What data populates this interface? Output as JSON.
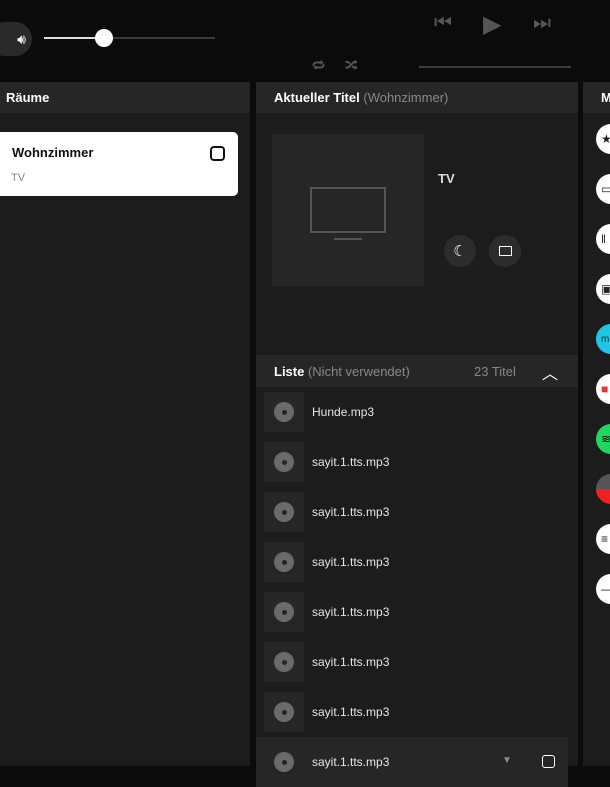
{
  "player": {
    "volume_percent": 35,
    "progress_percent": 0
  },
  "rooms": {
    "title": "Räume",
    "items": [
      {
        "name": "Wohnzimmer",
        "device": "TV"
      }
    ]
  },
  "current": {
    "title": "Aktueller Titel",
    "room": "(Wohnzimmer)",
    "track": "TV"
  },
  "list": {
    "title": "Liste",
    "status": "(Nicht verwendet)",
    "count": "23 Titel",
    "items": [
      "Hunde.mp3",
      "sayit.1.tts.mp3",
      "sayit.1.tts.mp3",
      "sayit.1.tts.mp3",
      "sayit.1.tts.mp3",
      "sayit.1.tts.mp3",
      "sayit.1.tts.mp3",
      "sayit.1.tts.mp3"
    ]
  },
  "sources": {
    "title": "M"
  },
  "colors": {
    "amazon": "#1fc7e6",
    "spotify": "#1ed760"
  }
}
